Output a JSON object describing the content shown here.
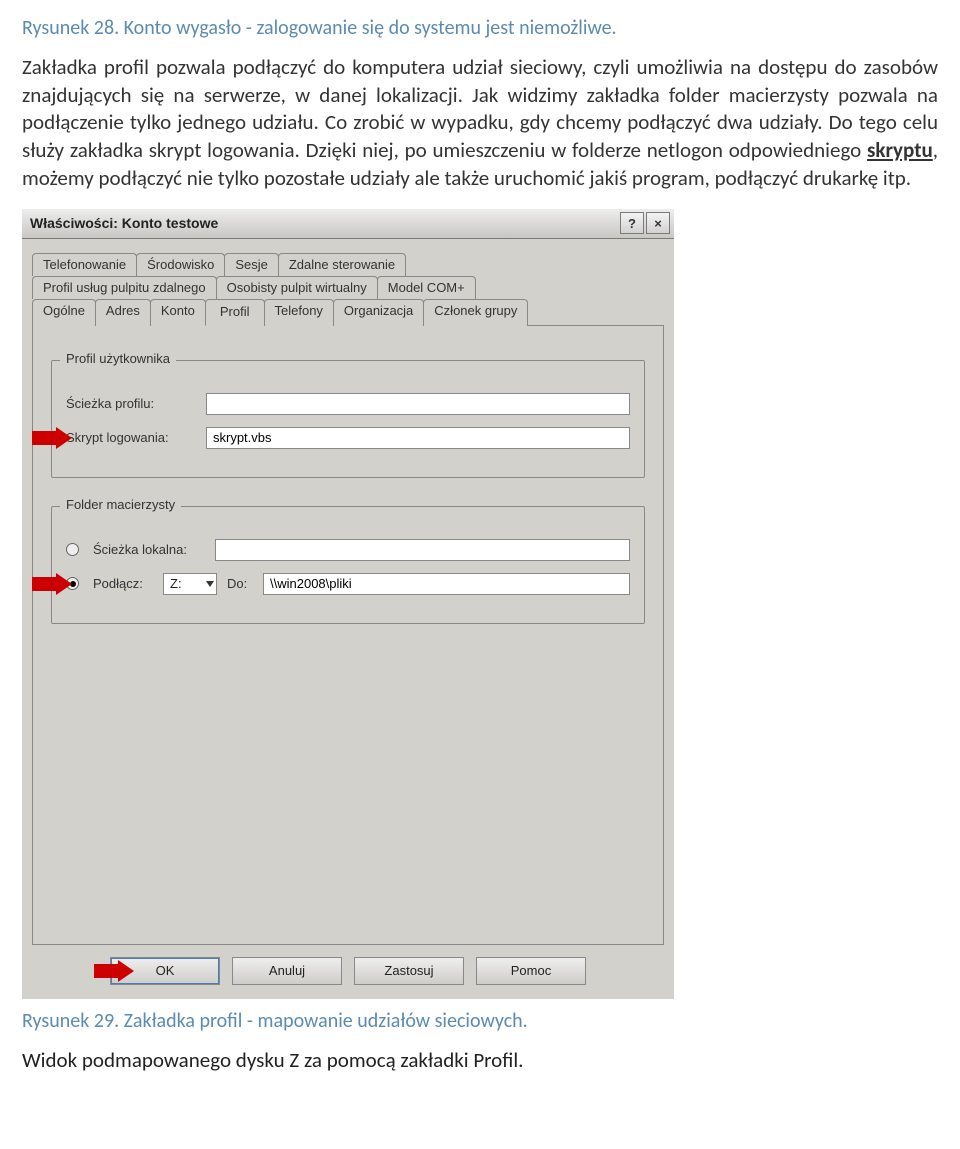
{
  "captions": {
    "fig28": "Rysunek 28. Konto wygasło - zalogowanie się do systemu jest niemożliwe.",
    "fig29": "Rysunek 29. Zakładka profil - mapowanie udziałów sieciowych."
  },
  "paragraph": {
    "p1_a": "Zakładka profil pozwala podłączyć do komputera udział sieciowy, czyli umożliwia na dostępu do zasobów znajdujących się na serwerze, w danej lokalizacji. Jak widzimy zakładka folder macierzysty pozwala na podłączenie tylko jednego udziału. Co zrobić w wypadku, gdy chcemy podłączyć dwa udziały. Do tego celu służy zakładka skrypt logowania. Dzięki niej, po umieszczeniu w folderze netlogon odpowiedniego ",
    "p1_link": "skryptu",
    "p1_b": ", możemy podłączyć nie tylko pozostałe udziały ale także uruchomić jakiś program, podłączyć drukarkę itp."
  },
  "dialog": {
    "title": "Właściwości: Konto testowe",
    "help": "?",
    "close": "×",
    "tabs": {
      "row1": [
        "Telefonowanie",
        "Środowisko",
        "Sesje",
        "Zdalne sterowanie"
      ],
      "row2": [
        "Profil usług pulpitu zdalnego",
        "Osobisty pulpit wirtualny",
        "Model COM+"
      ],
      "row3": [
        "Ogólne",
        "Adres",
        "Konto",
        "Profil",
        "Telefony",
        "Organizacja",
        "Członek grupy"
      ],
      "active": "Profil"
    },
    "group_user": {
      "legend": "Profil użytkownika",
      "path_label": "Ścieżka profilu:",
      "path_value": "",
      "script_label": "Skrypt logowania:",
      "script_value": "skrypt.vbs"
    },
    "group_home": {
      "legend": "Folder macierzysty",
      "local_label": "Ścieżka lokalna:",
      "local_value": "",
      "connect_label": "Podłącz:",
      "drive": "Z:",
      "to_label": "Do:",
      "to_value": "\\\\win2008\\pliki"
    },
    "buttons": {
      "ok": "OK",
      "cancel": "Anuluj",
      "apply": "Zastosuj",
      "help": "Pomoc"
    }
  },
  "endtext": "Widok podmapowanego dysku Z za pomocą zakładki Profil."
}
